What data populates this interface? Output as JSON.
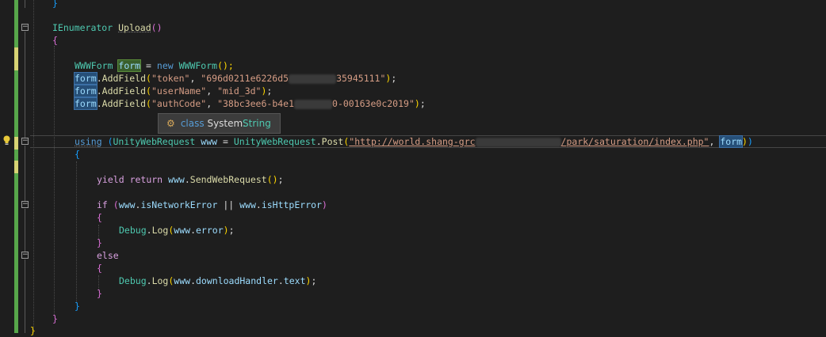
{
  "editor": {
    "lines": {
      "top_brace": "}",
      "method_keyword": "IEnumerator",
      "method_name": "Upload",
      "open_brace_1": "{",
      "wwwform_type": "WWWForm",
      "form_var": "form",
      "eq_new": " = ",
      "new_kw": "new",
      "wwwform_ctor": "WWWForm",
      "form_ref": "form",
      "addfield": "AddField",
      "token_key": "\"token\"",
      "token_val_start": "\"696d0211e6226d5",
      "token_val_end": "35945111\"",
      "username_key": "\"userName\"",
      "username_val": "\"mid_3d\"",
      "authcode_key": "\"authCode\"",
      "authcode_val_start": "\"38bc3ee6-b4e1",
      "authcode_val_end": "0-00163e0c2019\"",
      "using_kw": "using",
      "uwr_type": "UnityWebRequest",
      "www_var": "www",
      "post_method": "Post",
      "url_start": "\"http://world.shang-grc",
      "url_end": "/park/saturation/index.php\"",
      "open_brace_2": "{",
      "yield_kw": "yield",
      "return_kw": "return",
      "send_method": "SendWebRequest",
      "if_kw": "if",
      "is_network_error": "isNetworkError",
      "or_op": " || ",
      "is_http_error": "isHttpError",
      "debug_type": "Debug",
      "log_method": "Log",
      "error_prop": "error",
      "else_kw": "else",
      "download_handler": "downloadHandler",
      "text_prop": "text",
      "close_brace": "}"
    },
    "tooltip": {
      "keyword": "class",
      "name_prefix": "System.",
      "name_type": "String"
    }
  }
}
